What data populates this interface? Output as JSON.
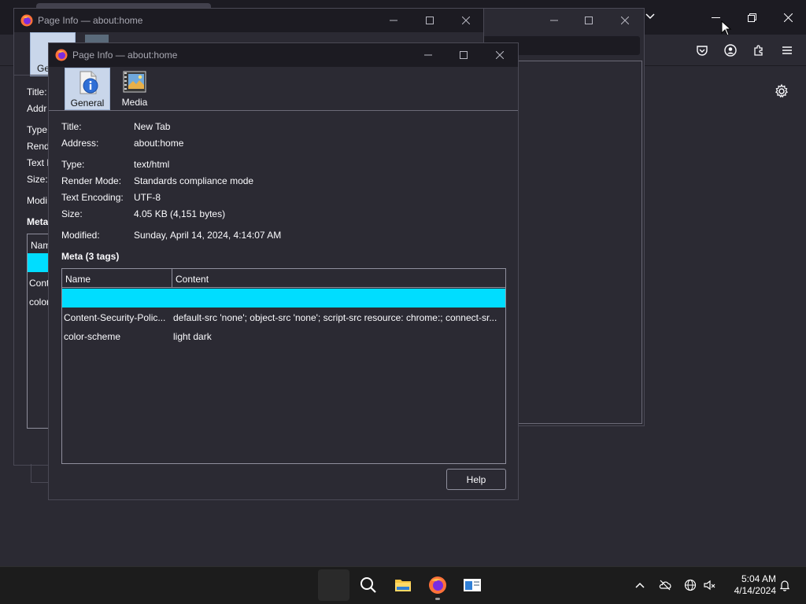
{
  "firefox_window": {
    "toolbar_icons": [
      "pocket-icon",
      "account-icon",
      "extensions-icon",
      "menu-icon"
    ],
    "settings_icon": "gear-icon"
  },
  "back_dialog": {
    "title": "Page Info — about:home",
    "general_tab_label": "Ge",
    "labels": [
      "Title:",
      "Addr",
      "Type:",
      "Rend",
      "Text E",
      "Size:",
      "Modi"
    ],
    "meta_label": "Meta",
    "meta_col_name": "Nam",
    "meta_rows": [
      "Conte",
      "color"
    ]
  },
  "dialog": {
    "title": "Page Info — about:home",
    "tabs": [
      {
        "label": "General",
        "icon": "info-document-icon",
        "selected": true
      },
      {
        "label": "Media",
        "icon": "media-image-icon",
        "selected": false
      }
    ],
    "fields": [
      {
        "label": "Title:",
        "value": "New Tab"
      },
      {
        "label": "Address:",
        "value": "about:home"
      },
      {
        "label": "Type:",
        "value": "text/html"
      },
      {
        "label": "Render Mode:",
        "value": "Standards compliance mode"
      },
      {
        "label": "Text Encoding:",
        "value": "UTF-8"
      },
      {
        "label": "Size:",
        "value": "4.05 KB (4,151 bytes)"
      },
      {
        "label": "Modified:",
        "value": "Sunday, April 14, 2024, 4:14:07 AM"
      }
    ],
    "meta_title": "Meta (3 tags)",
    "meta_columns": [
      "Name",
      "Content"
    ],
    "meta_rows": [
      {
        "name": "",
        "content": "",
        "selected": true
      },
      {
        "name": "Content-Security-Polic...",
        "content": "default-src 'none'; object-src 'none'; script-src resource: chrome:; connect-sr...",
        "selected": false
      },
      {
        "name": "color-scheme",
        "content": "light dark",
        "selected": false
      }
    ],
    "help_label": "Help"
  },
  "taskbar": {
    "apps": [
      "start-button",
      "search-icon",
      "file-explorer-icon",
      "firefox-icon",
      "window-app-icon"
    ],
    "time": "5:04 AM",
    "date": "4/14/2024"
  },
  "colors": {
    "selection": "#00ddff",
    "dialog_bg": "#2b2a33",
    "titlebar_bg": "#1c1b22",
    "taskbar_bg": "#1c1c1c"
  }
}
